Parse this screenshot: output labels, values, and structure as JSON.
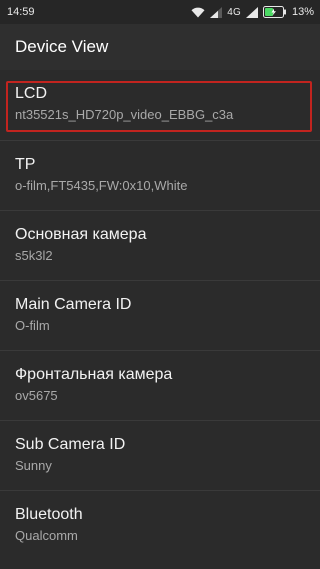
{
  "status_bar": {
    "time": "14:59",
    "network": "4G",
    "battery_percent": "13%",
    "icons": [
      "wifi-icon",
      "signal-icon",
      "signal-icon",
      "battery-charging-icon"
    ]
  },
  "app_bar": {
    "title": "Device View"
  },
  "items": [
    {
      "title": "LCD",
      "value": "nt35521s_HD720p_video_EBBG_c3a"
    },
    {
      "title": "TP",
      "value": "o-film,FT5435,FW:0x10,White"
    },
    {
      "title": "Основная камера",
      "value": "s5k3l2"
    },
    {
      "title": "Main Camera ID",
      "value": "O-film"
    },
    {
      "title": "Фронтальная камера",
      "value": "ov5675"
    },
    {
      "title": "Sub Camera ID",
      "value": "Sunny"
    },
    {
      "title": "Bluetooth",
      "value": "Qualcomm"
    }
  ],
  "colors": {
    "background": "#2b2b2b",
    "selection_border": "#c2241f",
    "battery_green": "#4cd964"
  }
}
